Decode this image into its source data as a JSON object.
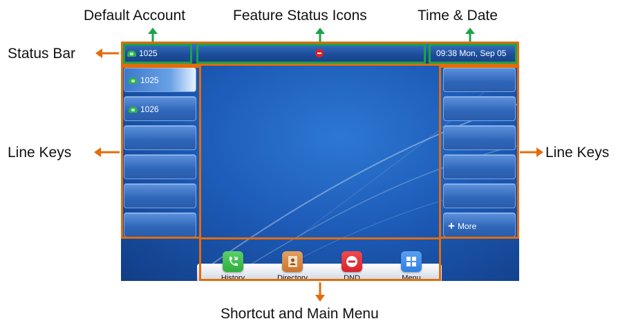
{
  "callouts": {
    "default_account": "Default Account",
    "feature_status_icons": "Feature Status Icons",
    "time_date": "Time & Date",
    "status_bar": "Status Bar",
    "line_keys_left": "Line Keys",
    "line_keys_right": "Line Keys",
    "shortcut_main_menu": "Shortcut and Main Menu"
  },
  "status_bar": {
    "account": "1025",
    "feature_icon": "dnd-icon",
    "datetime": "09:38 Mon, Sep 05"
  },
  "left_keys": [
    {
      "label": "1025",
      "icon": "handset-icon",
      "active": true
    },
    {
      "label": "1026",
      "icon": "handset-icon",
      "active": false
    },
    {
      "label": ""
    },
    {
      "label": ""
    },
    {
      "label": ""
    },
    {
      "label": ""
    }
  ],
  "right_keys": [
    {
      "label": ""
    },
    {
      "label": ""
    },
    {
      "label": ""
    },
    {
      "label": ""
    },
    {
      "label": ""
    },
    {
      "label": "More",
      "icon": "plus-icon"
    }
  ],
  "dock": [
    {
      "label": "History",
      "icon": "history-icon",
      "color": "#2fae3c"
    },
    {
      "label": "Directory",
      "icon": "directory-icon",
      "color": "#c9742c"
    },
    {
      "label": "DND",
      "icon": "dnd-icon",
      "color": "#d8232a"
    },
    {
      "label": "Menu",
      "icon": "menu-grid-icon",
      "color": "#2f7fe0"
    }
  ],
  "colors": {
    "green_highlight": "#1aa34a",
    "orange_highlight": "#e36c0a",
    "screen_blue": "#1d5cb8"
  }
}
